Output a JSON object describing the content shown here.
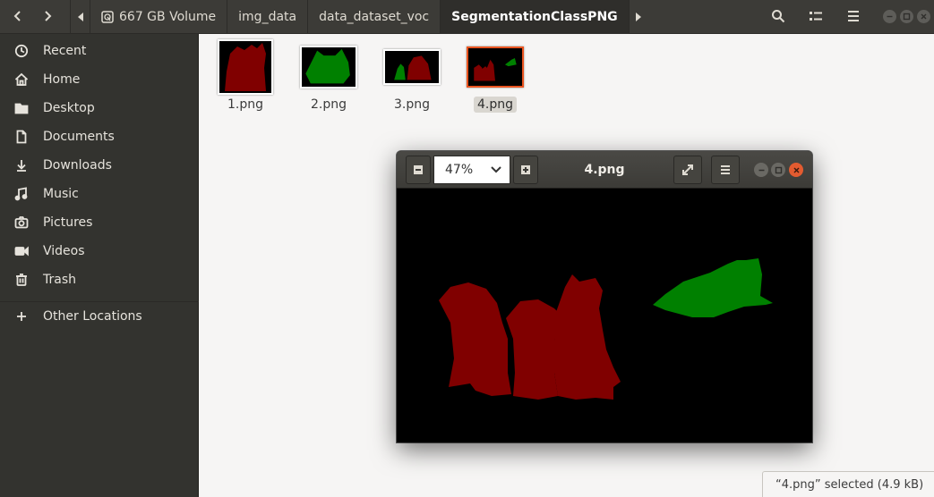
{
  "header": {
    "breadcrumbs": [
      {
        "label": "667 GB Volume"
      },
      {
        "label": "img_data"
      },
      {
        "label": "data_dataset_voc"
      },
      {
        "label": "SegmentationClassPNG"
      }
    ]
  },
  "sidebar": {
    "items": [
      {
        "label": "Recent",
        "icon": "clock-icon"
      },
      {
        "label": "Home",
        "icon": "home-icon"
      },
      {
        "label": "Desktop",
        "icon": "folder-icon"
      },
      {
        "label": "Documents",
        "icon": "document-icon"
      },
      {
        "label": "Downloads",
        "icon": "download-icon"
      },
      {
        "label": "Music",
        "icon": "music-icon"
      },
      {
        "label": "Pictures",
        "icon": "camera-icon"
      },
      {
        "label": "Videos",
        "icon": "video-icon"
      },
      {
        "label": "Trash",
        "icon": "trash-icon"
      },
      {
        "label": "Other Locations",
        "icon": "plus-icon"
      }
    ]
  },
  "files": [
    {
      "name": "1.png",
      "selected": false
    },
    {
      "name": "2.png",
      "selected": false
    },
    {
      "name": "3.png",
      "selected": false
    },
    {
      "name": "4.png",
      "selected": true
    }
  ],
  "viewer": {
    "title": "4.png",
    "zoom": "47%"
  },
  "status": {
    "text": "“4.png” selected  (4.9 kB)"
  },
  "colors": {
    "segment_red": "#800000",
    "segment_green": "#008000",
    "accent": "#e95420"
  }
}
